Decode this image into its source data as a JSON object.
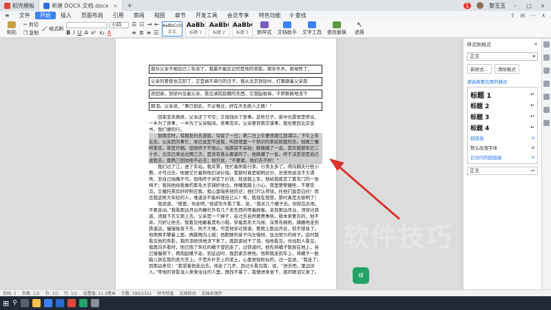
{
  "titlebar": {
    "tabs": [
      {
        "label": "稻壳模板",
        "color": "#d94a38"
      },
      {
        "label": "新建 DOCX 文档.docx",
        "color": "#2b6fd8"
      }
    ],
    "right_badge": "1",
    "user": "黎玉玉"
  },
  "menubar": {
    "menu_icon": "≡",
    "file": "文件",
    "items": [
      "开始",
      "插入",
      "页面布局",
      "引用",
      "审阅",
      "视图",
      "章节",
      "开发工具",
      "会员专享",
      "特色功能"
    ],
    "search_label": "查找",
    "right_items": [
      "⇪",
      "⊟",
      "⋯",
      "∧"
    ]
  },
  "ribbon": {
    "paste": "粘贴",
    "cut": "剪切",
    "copy": "复制",
    "format_painter": "格式刷",
    "font_size": "小四",
    "format_buttons": [
      "B",
      "I",
      "U",
      "A",
      "x²",
      "x₂",
      "A"
    ],
    "styles": [
      {
        "preview": "AaBbCcDd",
        "name": "正文"
      },
      {
        "preview": "AaBb",
        "name": "标题 1"
      },
      {
        "preview": "AaBb(",
        "name": "标题 2"
      },
      {
        "preview": "AaBbC",
        "name": "标题 3"
      }
    ],
    "new_style": "新样式",
    "doc_assistant": "文档助手",
    "text_tools": "文字工具",
    "find_replace": "查找替换",
    "select": "选择"
  },
  "document": {
    "boxed_lines": [
      "我与父亲不相见已二年余了，我最不能忘记的是他的背影。那年冬天，祖母死了，",
      "父亲的差使也交卸了，正是祸不单行的日子，我从北京到徐州，打算跟着父亲奔",
      "丧回家。到徐州见着父亲，看见满院狼藉的东西，又想起祖母，不禁簌簌地流下",
      "眼泪。父亲说，“事已如此，不必难过，好在天无绝人之路！”"
    ],
    "para1": "回家变卖典质，父亲还了亏空；又借钱办了丧事。这些日子，家中光景很是惨淡，一半为了丧事，一半为了父亲赋闲。丧事完毕，父亲要到南京谋事，我也要回北京念书，我们便同行。",
    "para2": "到南京时，有朋友约去游逛，勾留了一日；第二日上午便须渡江到浦口，下午上车北去。父亲因为事忙，本已说定不送我，叫旅馆里一个熟识的茶房陪我同去。他再三嘱咐茶房，甚是仔细。但他终于不放心，怕茶房不妥帖；颇踌躇了一会。其实我那年已二十岁，北京已来往过两三次，是没有甚么要紧的了。他踌躇了一会，终于决定还是自己送我去。我两三回劝他不必去；他只说，“不要紧，他们去不好！”",
    "para3": "我们过了江，进了车站。我买票，他忙着照看行李。行李太多了，得向脚夫行些小费，才可过去。他便又忙着和他们讲价钱。我那时真是聪明过分，总觉他说话不大漂亮，非自己插嘴不可。但他终于讲定了价钱；就送我上车。他给我拣定了靠车门的一张椅子；我将他给我做的紫毛大衣铺好坐位。他嘱我路上小心，夜里要警醒些，不要受凉。又嘱托茶房好好照应我。我心里暗笑他的迂；他们只认得钱，托他们直是白托！而且我这样大年纪的人，难道还不能料理自己么？唉，我现在想想，那时真是太聪明了！",
    "para4": "我说道，“爸爸，你走吧。”他望车外看了看，说，“我买几个橘子去。你就在此地，不要走动。”我看那边月台的栅栏外有几个卖东西的等着顾客。走到那边月台，须穿过铁道，须跳下去又爬上去。父亲是一个胖子，走过去自然要费事些。我本来要去的，他不肯，只好让他去。我看见他戴着黑布小帽，穿着黑布大马褂，深青布棉袍，蹒跚地走到铁道边，慢慢探身下去，尚不大难。可是他穿过铁道，要爬上那边月台，就不容易了。他用两手攀着上面，两脚再向上缩；他肥胖的身子向左微倾，显出努力的样子。这时我看见他的背影，我的泪很快地流下来了。我赶紧拭干了泪，怕他看见，也怕别人看见。我再向外看时，他已抱了朱红的橘子望回走了。过铁道时，他先将橘子散放在地上，自己慢慢爬下，再抱起橘子走。到这边时，我赶紧去搀他。他和我走到车上，将橘子一股脑儿放在我的皮大衣上。于是扑扑衣上的泥土，心里很轻松似的，过一会说，“我走了；到那边来信！”我望着他走出去。他走了几步，回过头看见我，说，“进去吧，里边没人。”等他的背影混入来来往往的人里，再找不着了，我便进来坐下，我的眼泪又来了。",
    "watermark": "软件技巧",
    "badge": "绿"
  },
  "panel": {
    "title": "样式和格式",
    "current_style": "正文",
    "new_style_btn": "新样式...",
    "clear_format_btn": "清除格式",
    "apply_label": "请选择要应用的格式",
    "headings": [
      "标题 1",
      "标题 2",
      "标题 3",
      "标题 4"
    ],
    "small_items": [
      {
        "label": "超链接",
        "plain": false
      },
      {
        "label": "默认段落字体",
        "plain": true
      },
      {
        "label": "已访问的超链接",
        "plain": false
      }
    ],
    "normal": "正文",
    "return_mark": "↵"
  },
  "vtool": {
    "items": [
      "样式",
      "选择",
      "形状",
      "工具",
      "分享",
      "帮助",
      "风格"
    ]
  },
  "statusbar": {
    "items": [
      "页码: 1",
      "页面: 1/2",
      "节: 1/1",
      "行: 1/1",
      "设置值: 11.3厘米",
      "字数: 190/1321",
      "拼写检查",
      "文档校对",
      "文档未保护"
    ]
  },
  "colors": {
    "accent": "#3b82f6",
    "arrow": "#d9322e"
  }
}
